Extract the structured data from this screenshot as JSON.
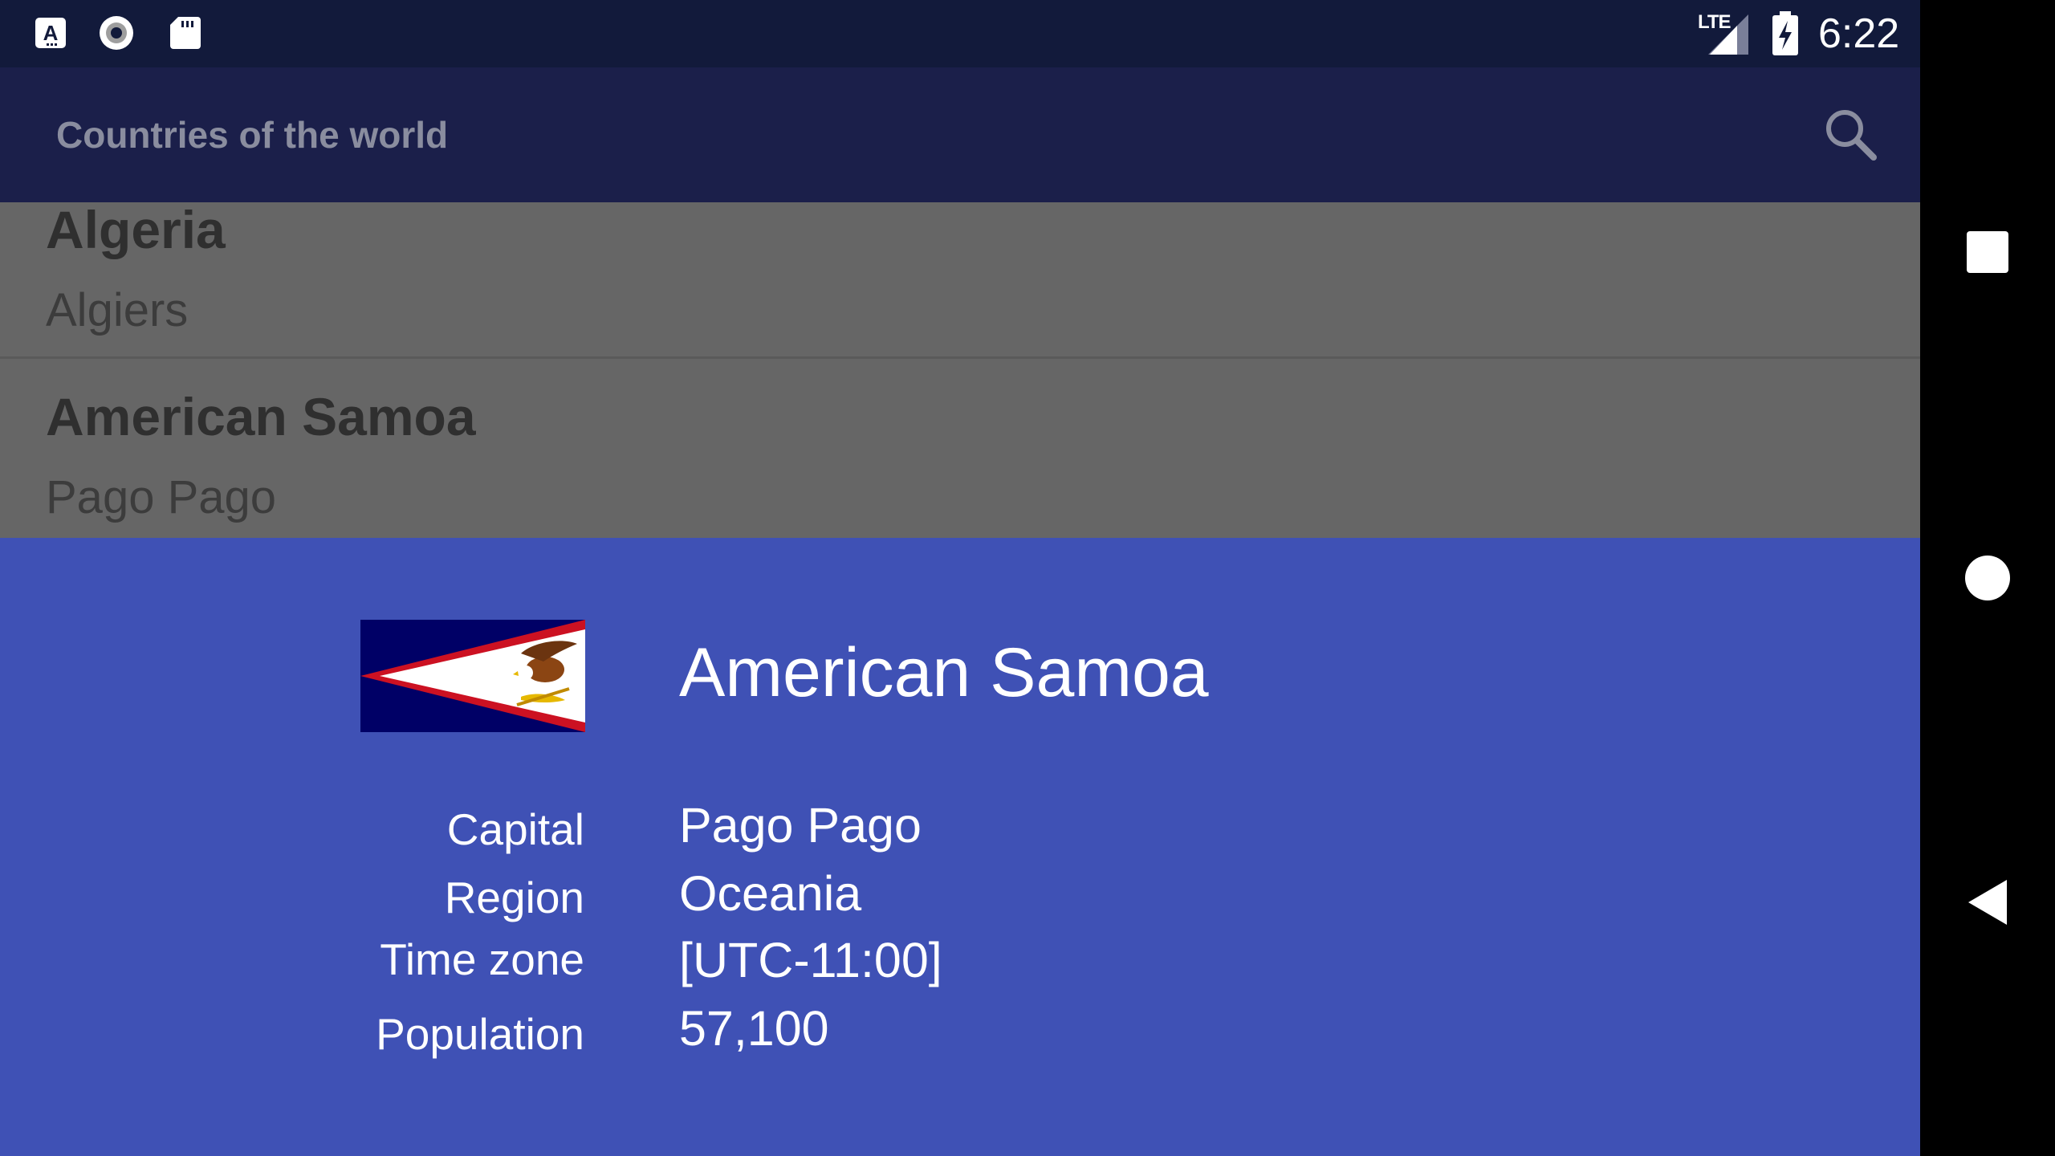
{
  "status_bar": {
    "time": "6:22",
    "network": "LTE",
    "icons": [
      "keyboard-a-icon",
      "record-circle-icon",
      "sd-card-icon",
      "signal-icon",
      "battery-charging-icon"
    ]
  },
  "app_bar": {
    "title": "Countries of the world",
    "search_icon": "search-icon"
  },
  "list": {
    "items": [
      {
        "name": "Algeria",
        "capital": "Algiers"
      },
      {
        "name": "American Samoa",
        "capital": "Pago Pago"
      }
    ]
  },
  "detail": {
    "country": "American Samoa",
    "fields": [
      {
        "label": "Capital",
        "value": "Pago Pago"
      },
      {
        "label": "Region",
        "value": "Oceania"
      },
      {
        "label": "Time zone",
        "value": "[UTC-11:00]"
      },
      {
        "label": "Population",
        "value": "57,100"
      }
    ]
  },
  "nav_bar": {
    "icons": [
      "recents-square-icon",
      "home-circle-icon",
      "back-triangle-icon"
    ]
  },
  "colors": {
    "status_bar_bg": "#121a3b",
    "app_bar_bg": "#1b1f4a",
    "list_bg": "#666666",
    "sheet_bg": "#3f51b5"
  }
}
